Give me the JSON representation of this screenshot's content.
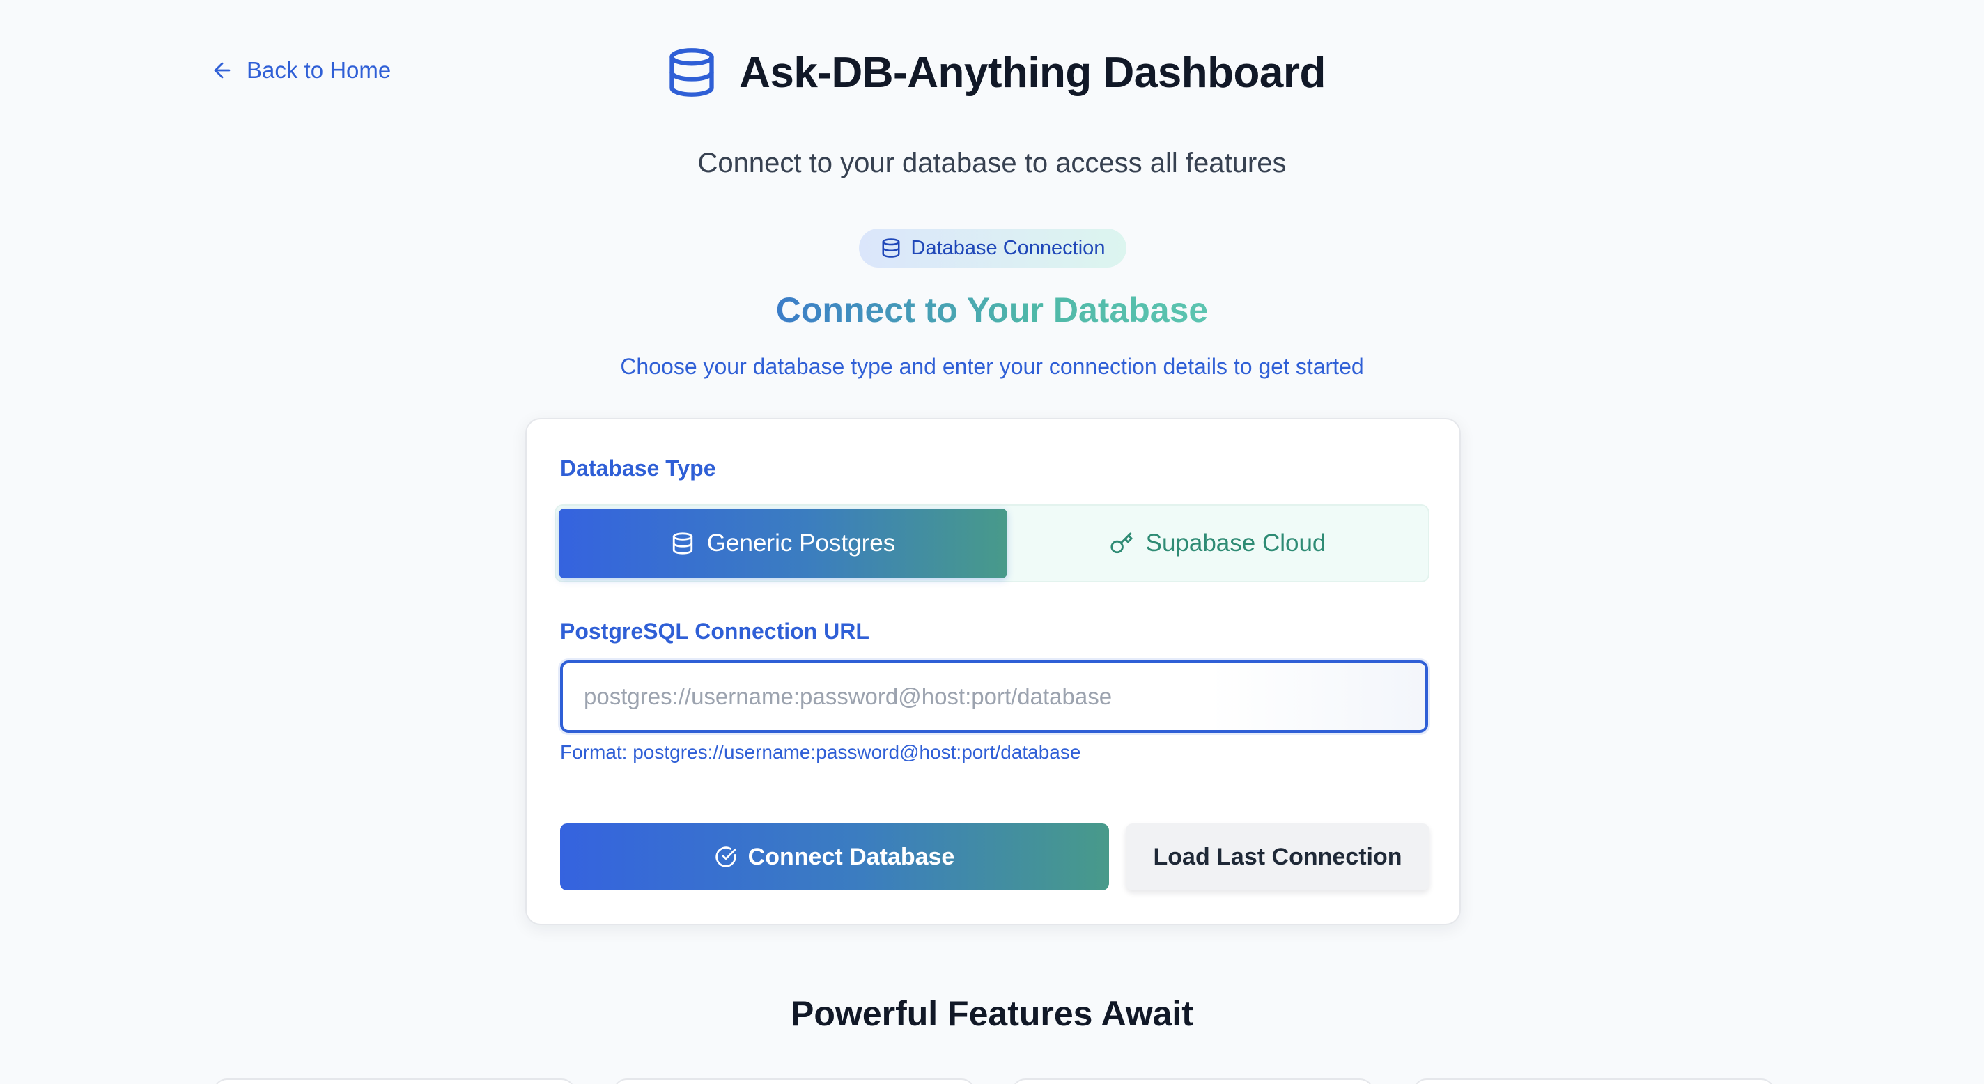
{
  "header": {
    "back_label": "Back to Home",
    "title": "Ask-DB-Anything Dashboard",
    "subtitle": "Connect to your database to access all features"
  },
  "connection_section": {
    "badge": "Database Connection",
    "title": "Connect to Your Database",
    "description": "Choose your database type and enter your connection details to get started"
  },
  "form": {
    "db_type_label": "Database Type",
    "db_types": [
      {
        "label": "Generic Postgres",
        "icon": "database-icon",
        "selected": true
      },
      {
        "label": "Supabase Cloud",
        "icon": "key-icon",
        "selected": false
      }
    ],
    "url_label": "PostgreSQL Connection URL",
    "url_value": "",
    "url_placeholder": "postgres://username:password@host:port/database",
    "format_hint": "Format: postgres://username:password@host:port/database",
    "connect_label": "Connect Database",
    "load_last_label": "Load Last Connection"
  },
  "features": {
    "title": "Powerful Features Await"
  },
  "colors": {
    "accent_blue": "#2f5fd6",
    "accent_teal": "#489a8a",
    "background": "#f8fafc"
  }
}
